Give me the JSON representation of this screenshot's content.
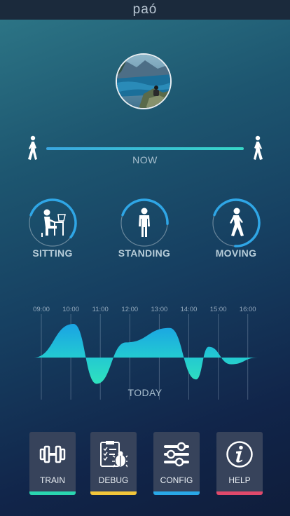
{
  "app": {
    "title": "paó"
  },
  "profile": {
    "avatar_alt": "profile photo"
  },
  "timeline": {
    "now_label": "NOW"
  },
  "activities": [
    {
      "label": "SITTING",
      "icon": "sitting-at-desk-icon",
      "progress": 0.55
    },
    {
      "label": "STANDING",
      "icon": "standing-person-icon",
      "progress": 0.45
    },
    {
      "label": "MOVING",
      "icon": "walking-person-icon",
      "progress": 0.7
    }
  ],
  "chart_data": {
    "type": "area",
    "categories": [
      "09:00",
      "10:00",
      "11:00",
      "12:00",
      "13:00",
      "14:00",
      "15:00",
      "16:00"
    ],
    "series": [
      {
        "values": [
          0.0,
          1.0,
          -0.78,
          0.45,
          0.88,
          -0.65,
          0.32,
          -0.2,
          0.0
        ]
      }
    ],
    "x_range": [
      "08:45",
      "16:20"
    ],
    "gridlines": true,
    "colors": {
      "top": "#1ba6e2",
      "bottom": "#2ad6c2"
    }
  },
  "today_label": "TODAY",
  "nav": [
    {
      "label": "TRAIN",
      "icon": "dumbbell-icon",
      "color": "#2ad6b0"
    },
    {
      "label": "DEBUG",
      "icon": "clipboard-bug-icon",
      "color": "#f2c63a"
    },
    {
      "label": "CONFIG",
      "icon": "sliders-icon",
      "color": "#29a8e8"
    },
    {
      "label": "HELP",
      "icon": "info-icon",
      "color": "#e0496b"
    }
  ]
}
